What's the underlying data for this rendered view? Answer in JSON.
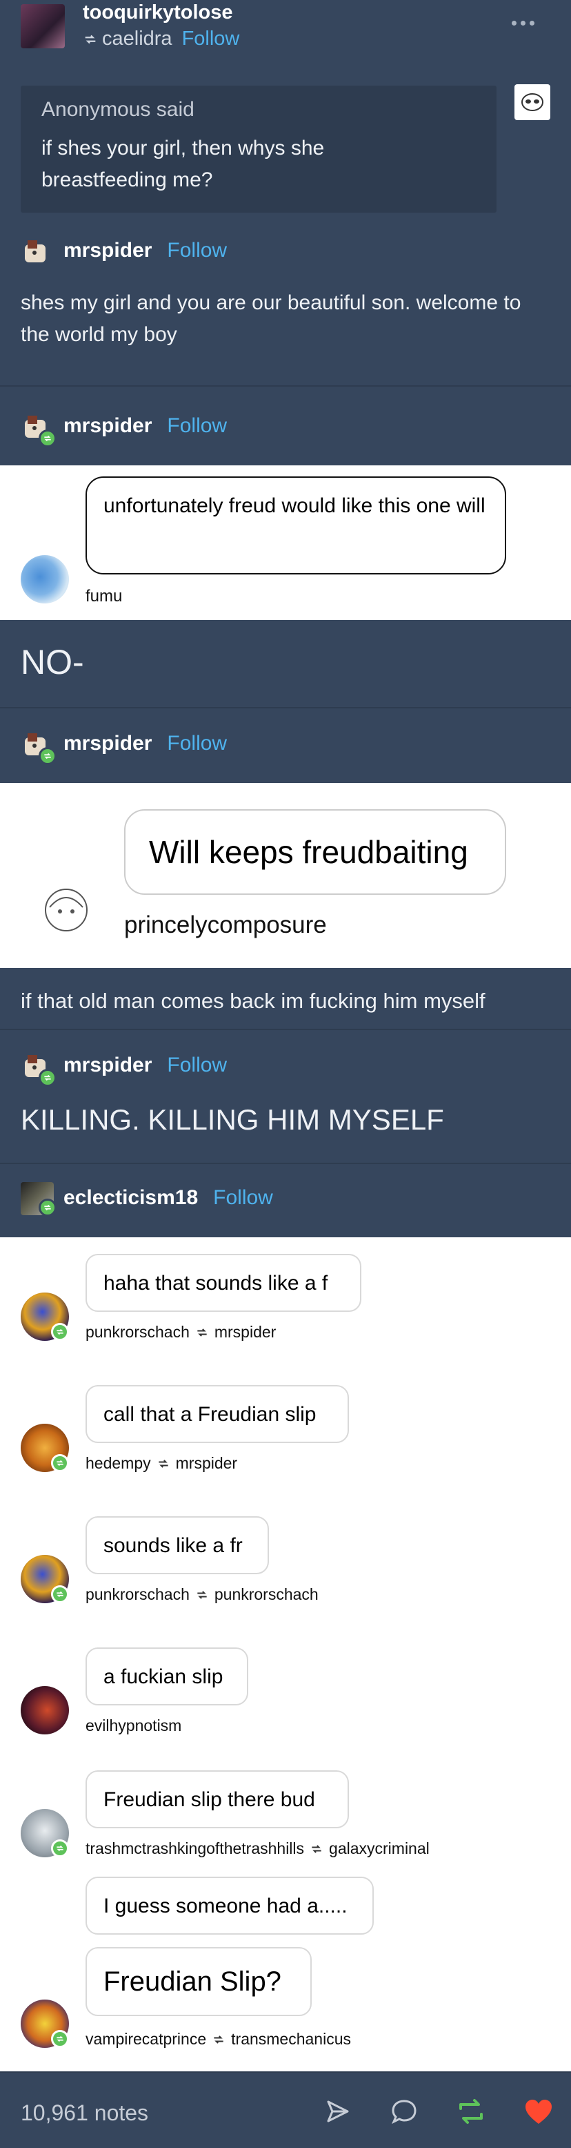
{
  "header": {
    "username": "tooquirkytolose",
    "reblogged_from": "caelidra",
    "follow_label": "Follow",
    "more_icon": "more-dots-icon"
  },
  "ask": {
    "asker": "Anonymous",
    "said": " said",
    "question": "if shes your girl, then whys she breastfeeding me?"
  },
  "answer": {
    "author": "mrspider",
    "follow_label": "Follow",
    "text": "shes my girl and you are our beautiful son. welcome to the world my boy"
  },
  "reblogs": [
    {
      "author": "mrspider",
      "follow_label": "Follow"
    },
    {
      "author": "mrspider",
      "follow_label": "Follow"
    },
    {
      "author": "mrspider",
      "follow_label": "Follow"
    },
    {
      "author": "eclecticism18",
      "follow_label": "Follow"
    }
  ],
  "screenshot1": {
    "message": "unfortunately freud would like this one will",
    "sender": "fumu"
  },
  "reply1": "NO-",
  "screenshot2": {
    "message": "Will keeps freudbaiting",
    "sender": "princelycomposure"
  },
  "reply2": "if that old man comes back im fucking him myself",
  "reply3": "KILLING. KILLING HIM MYSELF",
  "chat": [
    {
      "text": "haha that sounds like a f",
      "user": "punkrorschach",
      "via": "mrspider"
    },
    {
      "text": "call that a Freudian slip",
      "user": "hedempy",
      "via": "mrspider"
    },
    {
      "text": "sounds like a fr",
      "user": "punkrorschach",
      "via": "punkrorschach"
    },
    {
      "text": "a fuckian slip",
      "user": "evilhypnotism",
      "via": ""
    },
    {
      "text": "Freudian slip there bud",
      "user": "trashmctrashkingofthetrashhills",
      "via": "galaxycriminal"
    },
    {
      "text": "I guess someone had a.....",
      "user": "",
      "via": ""
    },
    {
      "text": "Freudian Slip?",
      "user": "vampirecatprince",
      "via": "transmechanicus"
    }
  ],
  "footer": {
    "notes": "10,961 notes",
    "icons": [
      "share-icon",
      "reply-icon",
      "reblog-icon",
      "like-icon"
    ]
  },
  "colors": {
    "background": "#36465d",
    "link": "#4fb3ee",
    "reblog_green": "#5ec25a",
    "like_red": "#ff4930"
  }
}
